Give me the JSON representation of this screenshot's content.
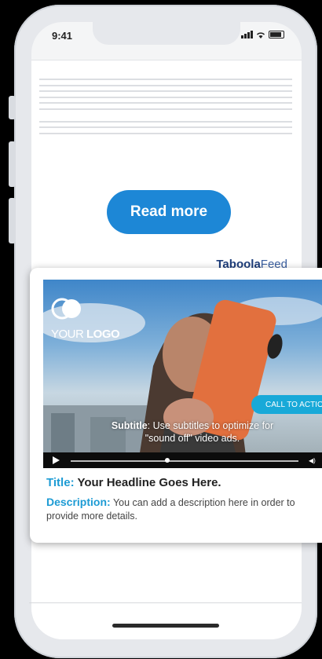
{
  "status": {
    "time": "9:41"
  },
  "article": {
    "read_more_label": "Read more"
  },
  "brand": {
    "name_part1": "Tab",
    "name_part2": "o",
    "name_part3": "ola",
    "suffix": "Feed"
  },
  "ad": {
    "logo_text_plain": "YOUR ",
    "logo_text_bold": "LOGO",
    "cta_label": "CALL TO ACTIO",
    "subtitle_label": "Subtitle",
    "subtitle_text": ": Use subtitles to optimize for",
    "subtitle_text2": "\"sound off\" video ads.",
    "title_label": "Title:",
    "title_text": "Your Headline Goes Here.",
    "description_label": "Description:",
    "description_text": "You can add a description here in order to provide more details."
  },
  "colors": {
    "accent": "#1d87d6",
    "label_blue": "#1d9bd4",
    "cta": "#18a9d8"
  }
}
